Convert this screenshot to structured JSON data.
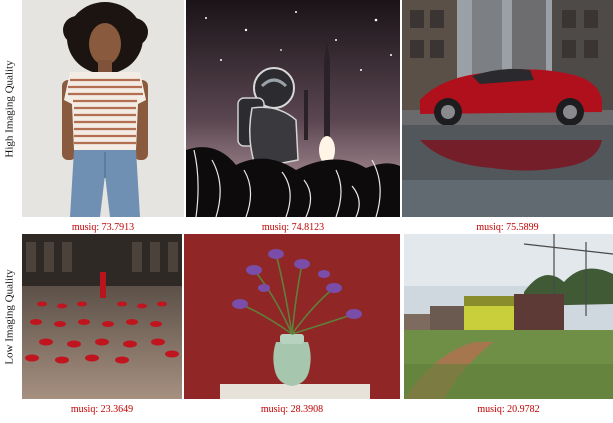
{
  "rows": [
    {
      "label": "High Imaging Quality",
      "images": [
        {
          "subject": "woman-striped-tshirt",
          "score_label": "musiq: 73.7913"
        },
        {
          "subject": "astronaut-rocket-illustration",
          "score_label": "musiq: 74.8123"
        },
        {
          "subject": "red-sports-car-street",
          "score_label": "musiq: 75.5899"
        }
      ]
    },
    {
      "label": "Low Imaging Quality",
      "images": [
        {
          "subject": "red-shoes-plaza",
          "score_label": "musiq: 23.3649"
        },
        {
          "subject": "iris-vase-red-wall",
          "score_label": "musiq: 28.3908"
        },
        {
          "subject": "train-countryside",
          "score_label": "musiq: 20.9782"
        }
      ]
    }
  ],
  "colors": {
    "score_text": "#c00000"
  }
}
